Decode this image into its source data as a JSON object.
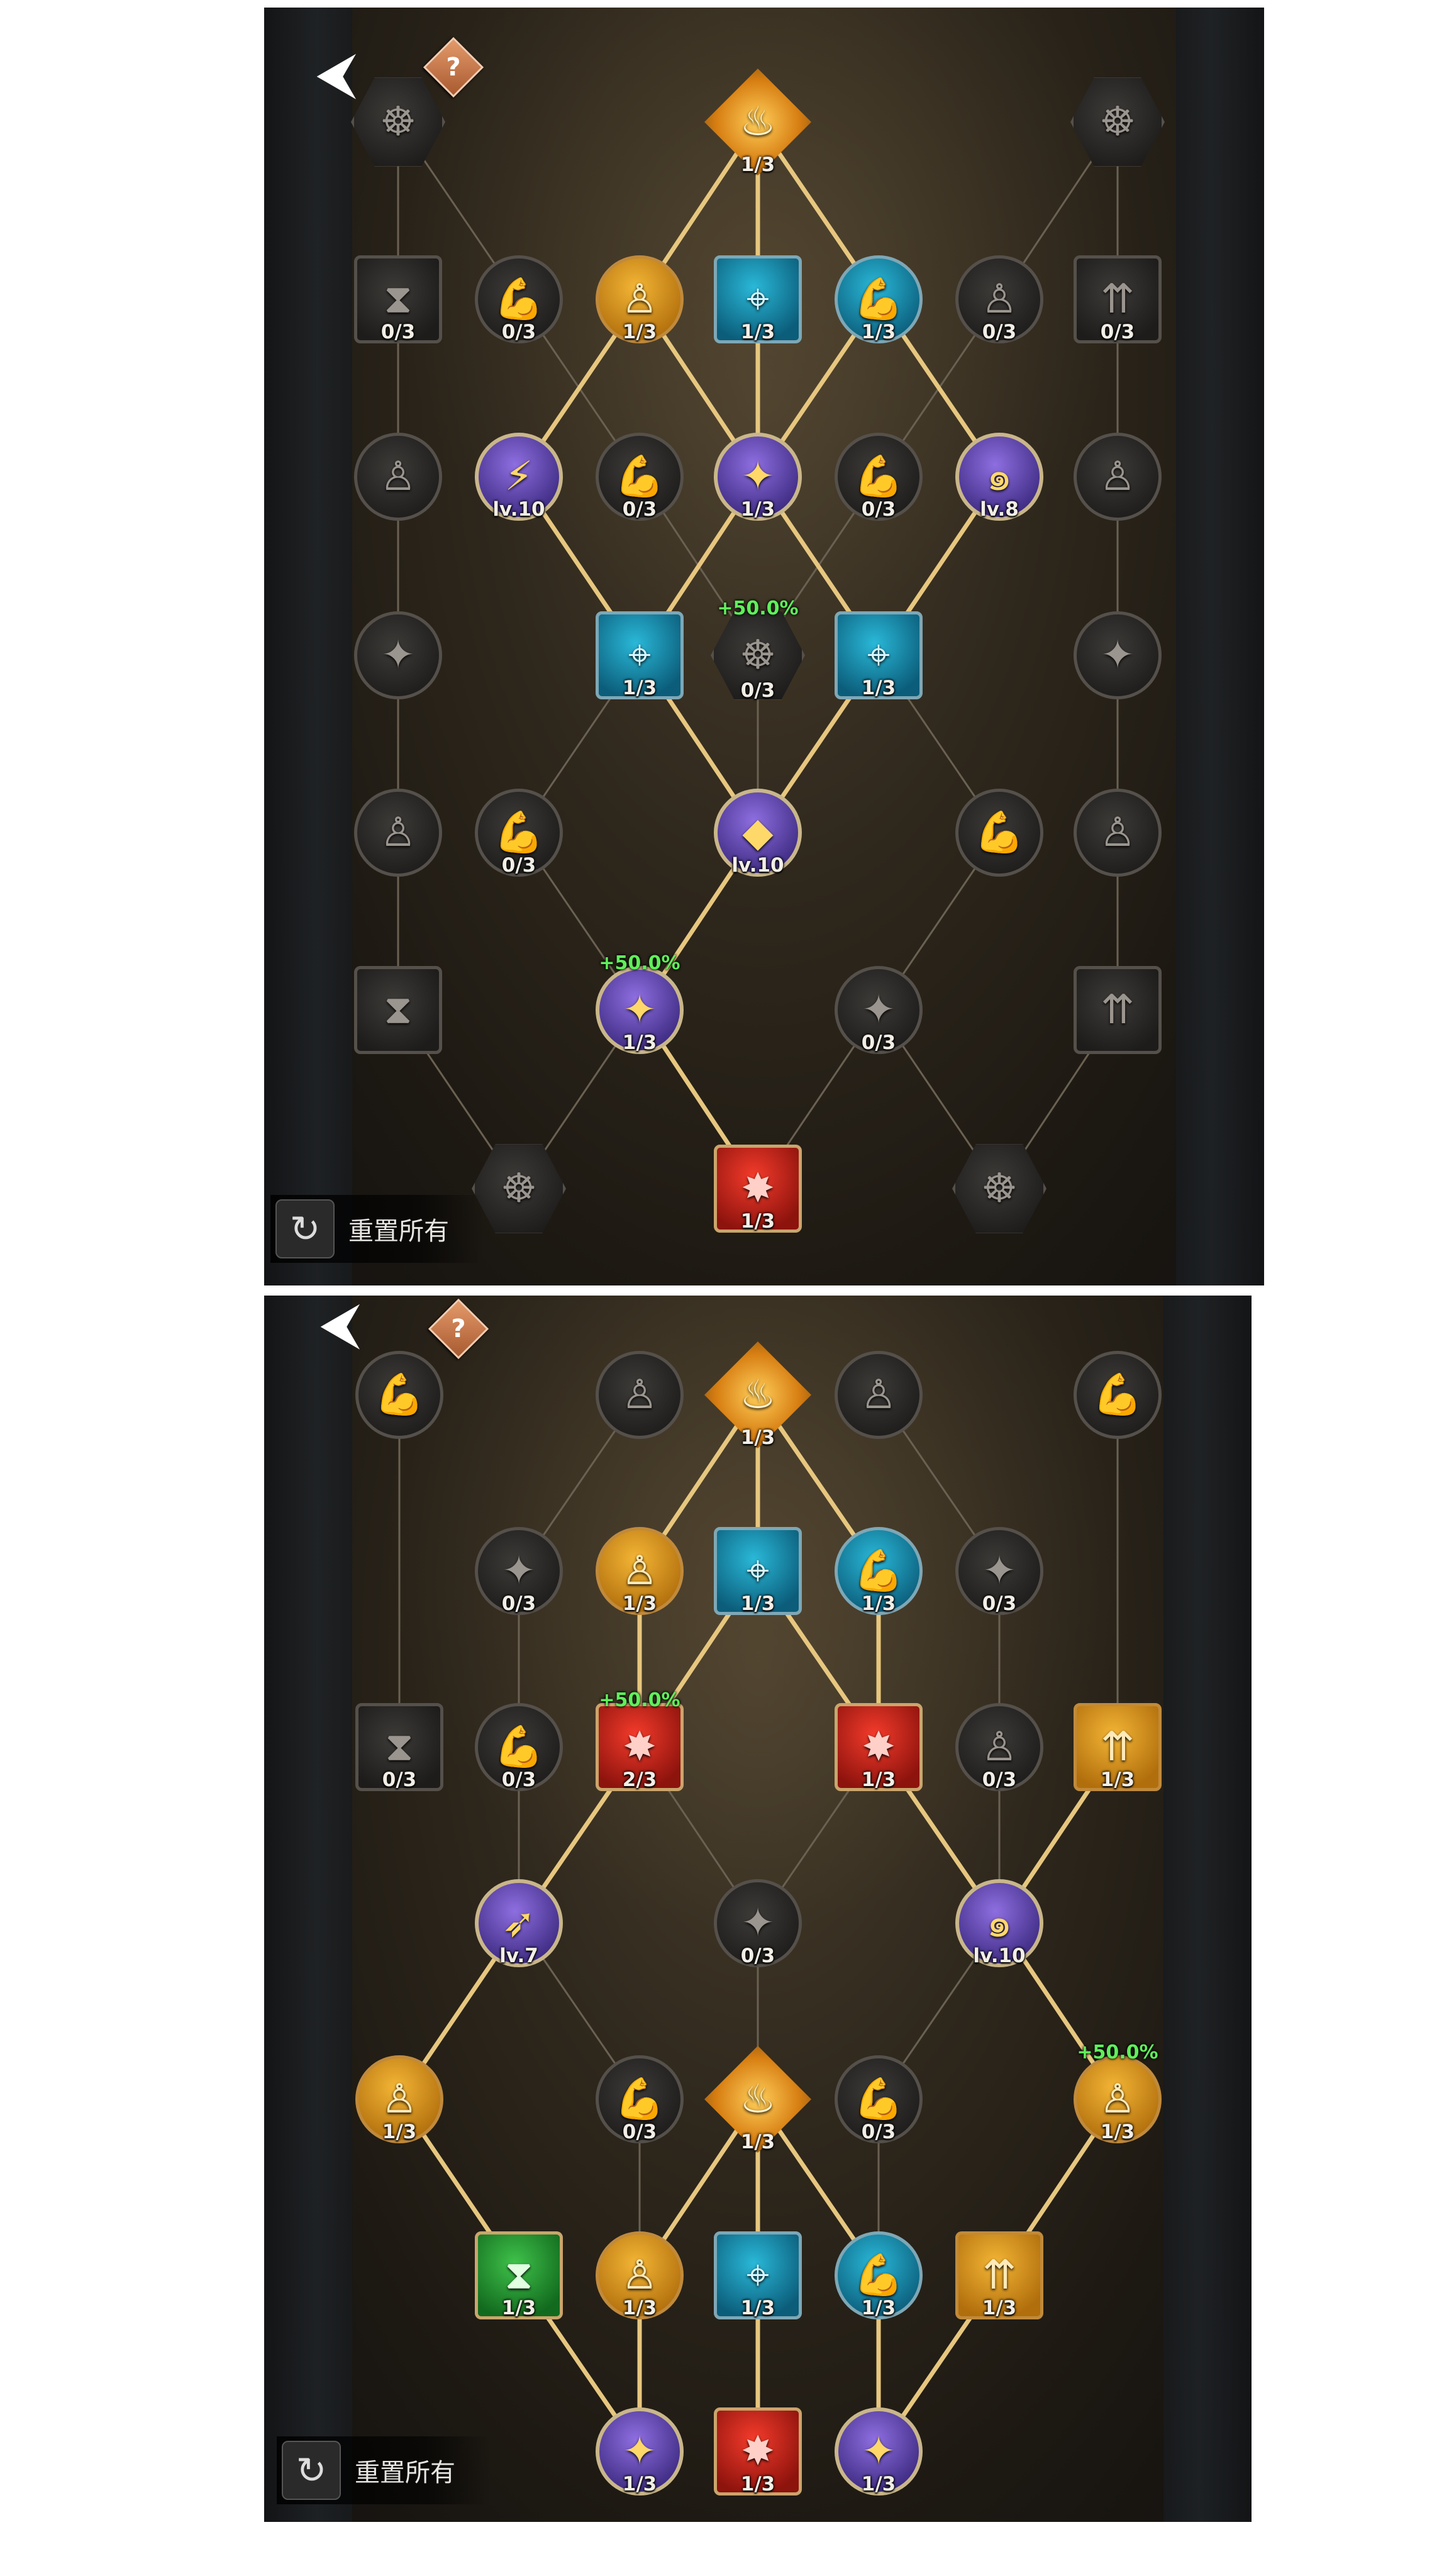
{
  "panels": [
    {
      "id": "top",
      "back_label": "⮜",
      "help_label": "?",
      "reset_label": "重置所有",
      "nodes": [
        {
          "id": "t-core",
          "shape": "dia",
          "state": "core",
          "icon": "flame-crest-icon",
          "level": "1/3"
        },
        {
          "id": "t-hex-l",
          "shape": "hex",
          "state": "locked",
          "icon": "body-aura-icon",
          "level": ""
        },
        {
          "id": "t-hex-r",
          "shape": "hex",
          "state": "locked",
          "icon": "body-aura-icon",
          "level": ""
        },
        {
          "id": "t-r1-1",
          "shape": "square",
          "state": "locked",
          "icon": "hourglass-icon",
          "level": "0/3"
        },
        {
          "id": "t-r1-2",
          "shape": "circle",
          "state": "locked",
          "icon": "arm-icon",
          "level": "0/3"
        },
        {
          "id": "t-r1-3",
          "shape": "circle",
          "state": "gold",
          "icon": "body-icon",
          "level": "1/3"
        },
        {
          "id": "t-r1-4",
          "shape": "square",
          "state": "blue",
          "icon": "crosshair-icon",
          "level": "1/3"
        },
        {
          "id": "t-r1-5",
          "shape": "circle",
          "state": "blue",
          "icon": "arm-icon",
          "level": "1/3"
        },
        {
          "id": "t-r1-6",
          "shape": "circle",
          "state": "locked",
          "icon": "body-icon",
          "level": "0/3"
        },
        {
          "id": "t-r1-7",
          "shape": "square",
          "state": "locked",
          "icon": "arrows-up-icon",
          "level": "0/3"
        },
        {
          "id": "t-r2-1",
          "shape": "circle",
          "state": "locked",
          "icon": "body-icon",
          "level": ""
        },
        {
          "id": "t-r2-2",
          "shape": "circle",
          "state": "purple",
          "icon": "blade-icon",
          "level": "lv.10"
        },
        {
          "id": "t-r2-3",
          "shape": "circle",
          "state": "locked",
          "icon": "arm-icon",
          "level": "0/3"
        },
        {
          "id": "t-r2-4",
          "shape": "circle",
          "state": "purple",
          "icon": "compass-icon",
          "level": "1/3"
        },
        {
          "id": "t-r2-5",
          "shape": "circle",
          "state": "locked",
          "icon": "arm-icon",
          "level": "0/3"
        },
        {
          "id": "t-r2-6",
          "shape": "circle",
          "state": "purple",
          "icon": "swirl-icon",
          "level": "lv.8"
        },
        {
          "id": "t-r2-7",
          "shape": "circle",
          "state": "locked",
          "icon": "body-icon",
          "level": ""
        },
        {
          "id": "t-r3-1",
          "shape": "circle",
          "state": "locked",
          "icon": "compass-icon",
          "level": ""
        },
        {
          "id": "t-r3-2",
          "shape": "square",
          "state": "blue",
          "icon": "crosshair-icon",
          "level": "1/3"
        },
        {
          "id": "t-r3-3",
          "shape": "hex",
          "state": "locked",
          "icon": "body-aura-icon",
          "level": "0/3",
          "bonus": "+50.0%"
        },
        {
          "id": "t-r3-4",
          "shape": "square",
          "state": "blue",
          "icon": "crosshair-icon",
          "level": "1/3"
        },
        {
          "id": "t-r3-5",
          "shape": "circle",
          "state": "locked",
          "icon": "compass-icon",
          "level": ""
        },
        {
          "id": "t-r4-1",
          "shape": "circle",
          "state": "locked",
          "icon": "body-icon",
          "level": ""
        },
        {
          "id": "t-r4-2",
          "shape": "circle",
          "state": "locked",
          "icon": "arm-icon",
          "level": "0/3"
        },
        {
          "id": "t-r4-3",
          "shape": "circle",
          "state": "purple",
          "icon": "diamond-icon",
          "level": "lv.10"
        },
        {
          "id": "t-r4-4",
          "shape": "circle",
          "state": "locked",
          "icon": "arm-icon",
          "level": ""
        },
        {
          "id": "t-r4-5",
          "shape": "circle",
          "state": "locked",
          "icon": "body-icon",
          "level": ""
        },
        {
          "id": "t-r5-1",
          "shape": "square",
          "state": "locked",
          "icon": "hourglass-icon",
          "level": ""
        },
        {
          "id": "t-r5-2",
          "shape": "circle",
          "state": "purple",
          "icon": "compass-icon",
          "level": "1/3",
          "bonus": "+50.0%"
        },
        {
          "id": "t-r5-3",
          "shape": "circle",
          "state": "locked",
          "icon": "compass-icon",
          "level": "0/3"
        },
        {
          "id": "t-r5-4",
          "shape": "square",
          "state": "locked",
          "icon": "arrows-up-icon",
          "level": ""
        },
        {
          "id": "t-r6-1",
          "shape": "hex",
          "state": "locked",
          "icon": "body-aura-icon",
          "level": ""
        },
        {
          "id": "t-r6-2",
          "shape": "square",
          "state": "red",
          "icon": "shield-star-icon",
          "level": "1/3"
        },
        {
          "id": "t-r6-3",
          "shape": "hex",
          "state": "locked",
          "icon": "body-aura-icon",
          "level": ""
        }
      ]
    },
    {
      "id": "bottom",
      "back_label": "⮜",
      "help_label": "?",
      "reset_label": "重置所有",
      "nodes": [
        {
          "id": "b-r0-1",
          "shape": "circle",
          "state": "locked",
          "icon": "arm-icon",
          "level": ""
        },
        {
          "id": "b-r0-2",
          "shape": "circle",
          "state": "locked",
          "icon": "body-icon",
          "level": ""
        },
        {
          "id": "b-core1",
          "shape": "dia",
          "state": "core",
          "icon": "flame-crest-icon",
          "level": "1/3"
        },
        {
          "id": "b-r0-3",
          "shape": "circle",
          "state": "locked",
          "icon": "body-icon",
          "level": ""
        },
        {
          "id": "b-r0-4",
          "shape": "circle",
          "state": "locked",
          "icon": "arm-icon",
          "level": ""
        },
        {
          "id": "b-r1-1",
          "shape": "circle",
          "state": "locked",
          "icon": "compass-icon",
          "level": "0/3"
        },
        {
          "id": "b-r1-2",
          "shape": "circle",
          "state": "gold",
          "icon": "body-icon",
          "level": "1/3"
        },
        {
          "id": "b-r1-3",
          "shape": "square",
          "state": "blue",
          "icon": "crosshair-icon",
          "level": "1/3"
        },
        {
          "id": "b-r1-4",
          "shape": "circle",
          "state": "blue",
          "icon": "arm-icon",
          "level": "1/3"
        },
        {
          "id": "b-r1-5",
          "shape": "circle",
          "state": "locked",
          "icon": "compass-icon",
          "level": "0/3"
        },
        {
          "id": "b-r2-1",
          "shape": "square",
          "state": "locked",
          "icon": "hourglass-icon",
          "level": "0/3"
        },
        {
          "id": "b-r2-2",
          "shape": "circle",
          "state": "locked",
          "icon": "arm-icon",
          "level": "0/3"
        },
        {
          "id": "b-r2-3",
          "shape": "square",
          "state": "red",
          "icon": "shield-star-icon",
          "level": "2/3",
          "bonus": "+50.0%"
        },
        {
          "id": "b-r2-4",
          "shape": "square",
          "state": "red",
          "icon": "shield-star-icon",
          "level": "1/3"
        },
        {
          "id": "b-r2-5",
          "shape": "circle",
          "state": "locked",
          "icon": "body-icon",
          "level": "0/3"
        },
        {
          "id": "b-r2-6",
          "shape": "square",
          "state": "gold",
          "icon": "arrows-up-icon",
          "level": "1/3"
        },
        {
          "id": "b-r3-1",
          "shape": "circle",
          "state": "purple",
          "icon": "boot-icon",
          "level": "lv.7"
        },
        {
          "id": "b-r3-2",
          "shape": "circle",
          "state": "locked",
          "icon": "compass-icon",
          "level": "0/3"
        },
        {
          "id": "b-r3-3",
          "shape": "circle",
          "state": "purple",
          "icon": "swirl-icon",
          "level": "lv.10"
        },
        {
          "id": "b-r4-1",
          "shape": "circle",
          "state": "gold",
          "icon": "body-icon",
          "level": "1/3"
        },
        {
          "id": "b-r4-2",
          "shape": "circle",
          "state": "locked",
          "icon": "arm-icon",
          "level": "0/3"
        },
        {
          "id": "b-core2",
          "shape": "dia",
          "state": "core",
          "icon": "flame-crest-icon",
          "level": "1/3"
        },
        {
          "id": "b-r4-3",
          "shape": "circle",
          "state": "locked",
          "icon": "arm-icon",
          "level": "0/3"
        },
        {
          "id": "b-r4-4",
          "shape": "circle",
          "state": "gold",
          "icon": "body-icon",
          "level": "1/3",
          "bonus": "+50.0%"
        },
        {
          "id": "b-r5-1",
          "shape": "square",
          "state": "green",
          "icon": "hourglass-icon",
          "level": "1/3"
        },
        {
          "id": "b-r5-2",
          "shape": "circle",
          "state": "gold",
          "icon": "body-icon",
          "level": "1/3"
        },
        {
          "id": "b-r5-3",
          "shape": "square",
          "state": "blue",
          "icon": "crosshair-icon",
          "level": "1/3"
        },
        {
          "id": "b-r5-4",
          "shape": "circle",
          "state": "blue",
          "icon": "arm-icon",
          "level": "1/3"
        },
        {
          "id": "b-r5-5",
          "shape": "square",
          "state": "gold",
          "icon": "arrows-up-icon",
          "level": "1/3"
        },
        {
          "id": "b-r6-1",
          "shape": "circle",
          "state": "purple",
          "icon": "compass-icon",
          "level": "1/3"
        },
        {
          "id": "b-r6-2",
          "shape": "square",
          "state": "red",
          "icon": "shield-star-icon",
          "level": "1/3"
        },
        {
          "id": "b-r6-3",
          "shape": "circle",
          "state": "purple",
          "icon": "compass-icon",
          "level": "1/3"
        }
      ]
    }
  ],
  "colors": {
    "path_active": "#e7c77f",
    "path_inactive": "#6a6152",
    "bonus_text": "#5ff05a"
  },
  "icon_glyphs": {
    "flame-crest-icon": "♨",
    "body-aura-icon": "☸",
    "hourglass-icon": "⧗",
    "arm-icon": "💪",
    "body-icon": "♙",
    "crosshair-icon": "⌖",
    "arrows-up-icon": "⇈",
    "blade-icon": "⚡",
    "compass-icon": "✦",
    "swirl-icon": "๑",
    "diamond-icon": "◆",
    "shield-star-icon": "✸",
    "boot-icon": "➶"
  }
}
